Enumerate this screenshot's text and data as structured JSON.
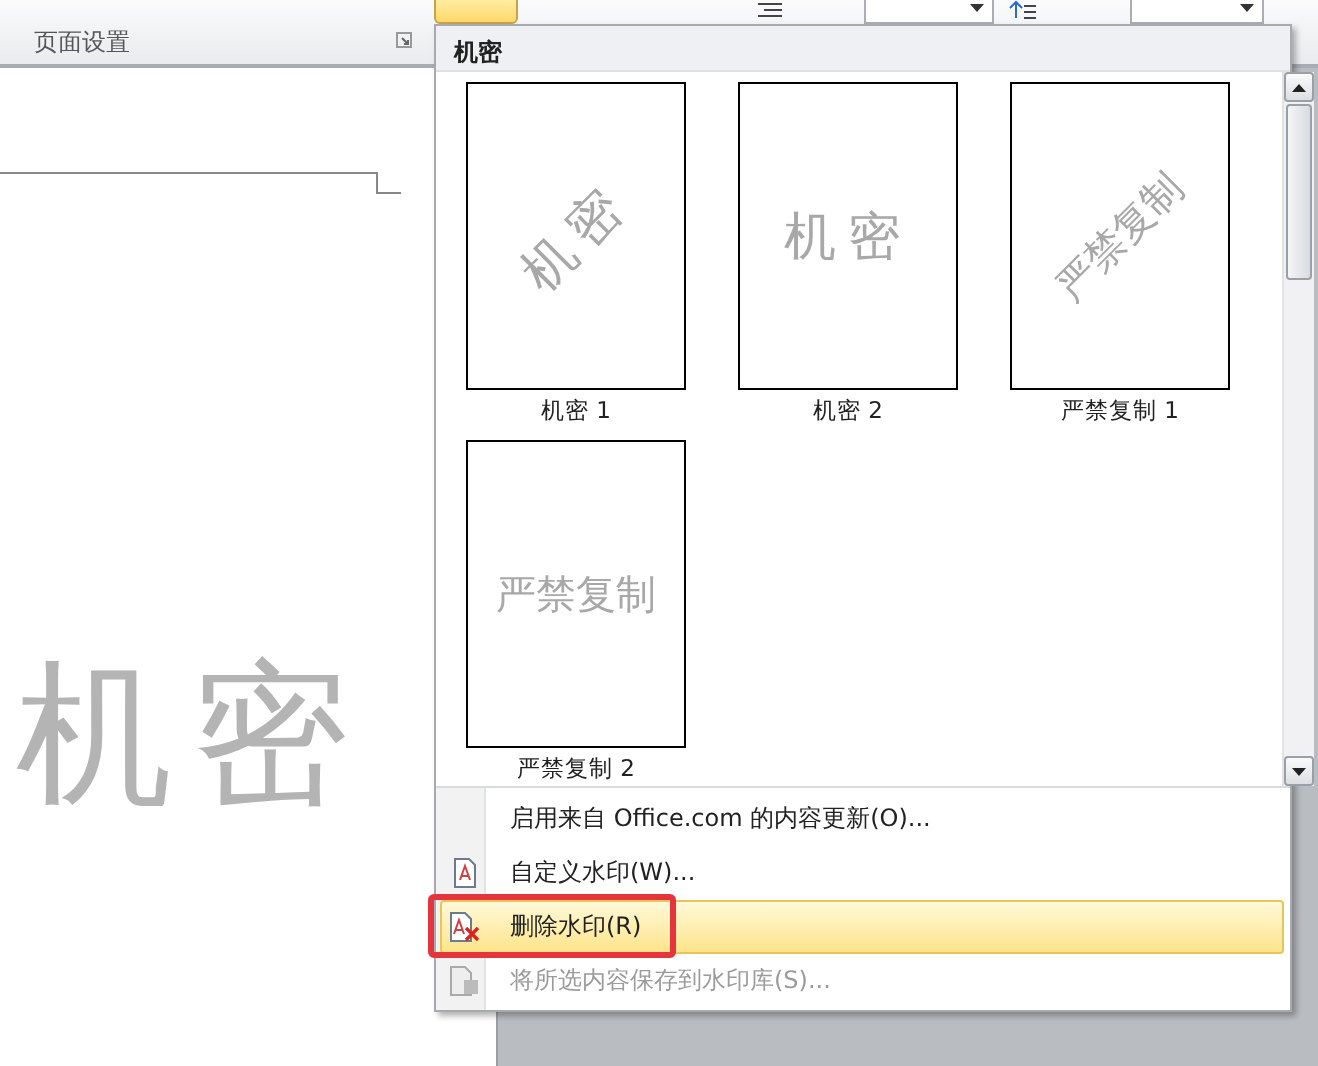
{
  "ribbon": {
    "group_label": "页面设置",
    "watermark_button": {
      "selected": true
    }
  },
  "document": {
    "watermark": "机密"
  },
  "watermark_menu": {
    "category": "机密",
    "gallery": [
      {
        "label": "机密 1",
        "watermark": "机密",
        "kind": "diagonal"
      },
      {
        "label": "机密 2",
        "watermark": "机密",
        "kind": "horizontal"
      },
      {
        "label": "严禁复制 1",
        "watermark": "严禁复制",
        "kind": "diagonal"
      },
      {
        "label": "严禁复制 2",
        "watermark": "严禁复制",
        "kind": "horizontal"
      }
    ],
    "items": [
      {
        "label": "启用来自 Office.com 的内容更新(O)...",
        "kind": "plain",
        "selected": false,
        "disabled": false,
        "annotated": false
      },
      {
        "label": "自定义水印(W)...",
        "kind": "custom",
        "selected": false,
        "disabled": false,
        "annotated": false
      },
      {
        "label": "删除水印(R)",
        "kind": "remove",
        "selected": true,
        "disabled": false,
        "annotated": true
      },
      {
        "label": "将所选内容保存到水印库(S)...",
        "kind": "save",
        "selected": false,
        "disabled": true,
        "annotated": false
      }
    ]
  }
}
